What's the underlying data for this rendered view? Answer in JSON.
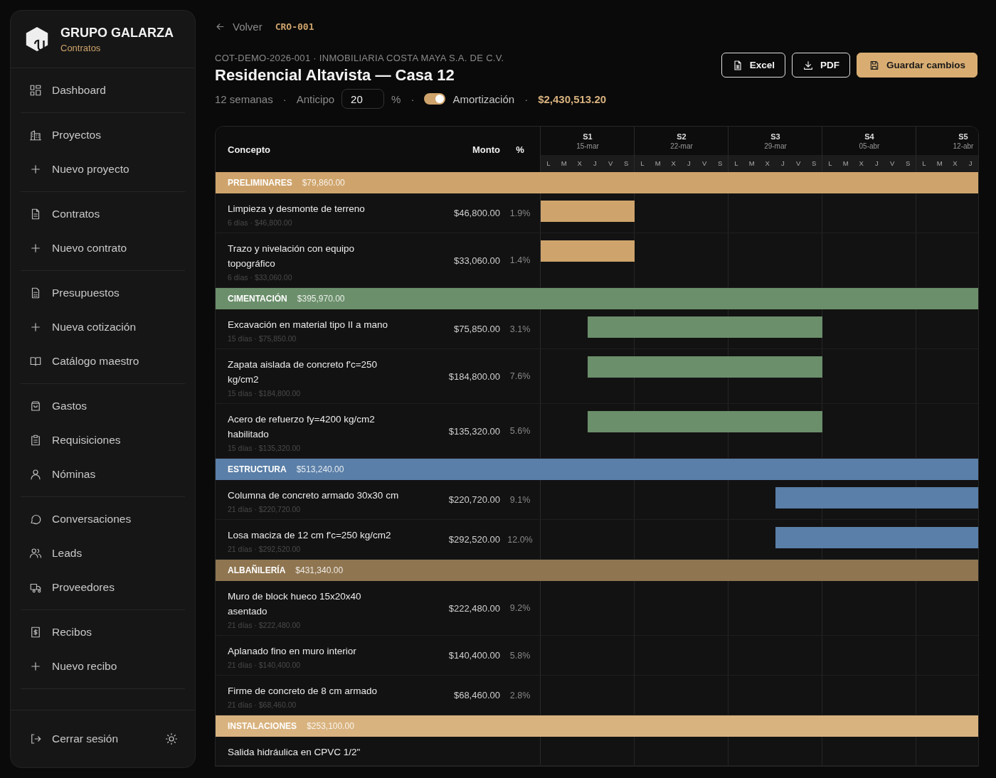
{
  "sidebar": {
    "brand": "GRUPO GALARZA",
    "subtitle": "Contratos",
    "groups": [
      [
        {
          "label": "Dashboard",
          "kind": "grid"
        }
      ],
      [
        {
          "label": "Proyectos",
          "kind": "building"
        },
        {
          "label": "Nuevo proyecto",
          "kind": "plus"
        }
      ],
      [
        {
          "label": "Contratos",
          "kind": "doc"
        },
        {
          "label": "Nuevo contrato",
          "kind": "plus"
        }
      ],
      [
        {
          "label": "Presupuestos",
          "kind": "calc"
        },
        {
          "label": "Nueva cotización",
          "kind": "plus"
        },
        {
          "label": "Catálogo maestro",
          "kind": "book"
        }
      ],
      [
        {
          "label": "Gastos",
          "kind": "bag"
        },
        {
          "label": "Requisiciones",
          "kind": "clipboard"
        },
        {
          "label": "Nóminas",
          "kind": "user"
        }
      ],
      [
        {
          "label": "Conversaciones",
          "kind": "chat"
        },
        {
          "label": "Leads",
          "kind": "users"
        },
        {
          "label": "Proveedores",
          "kind": "truck"
        }
      ],
      [
        {
          "label": "Recibos",
          "kind": "receipt"
        },
        {
          "label": "Nuevo recibo",
          "kind": "plus"
        }
      ]
    ],
    "logout": "Cerrar sesión"
  },
  "breadcrumb": {
    "back": "Volver",
    "code": "CRO-001"
  },
  "header": {
    "subtitle": "COT-DEMO-2026-001 · INMOBILIARIA COSTA MAYA S.A. DE C.V.",
    "title": "Residencial Altavista — Casa 12",
    "weeks": "12 semanas",
    "advance_label": "Anticipo",
    "advance_value": "20",
    "percent": "%",
    "separator": "·",
    "amortization": {
      "label": "Amortización",
      "on": true
    },
    "total": "$2,430,513.20"
  },
  "buttons": [
    {
      "label": "Excel",
      "kind": "excel"
    },
    {
      "label": "PDF",
      "kind": "pdf"
    },
    {
      "label": "Guardar cambios",
      "kind": "save"
    }
  ],
  "table": {
    "columns": [
      "Concepto",
      "Monto",
      "%"
    ],
    "weeks": [
      {
        "label": "S1",
        "date": "15-mar",
        "days": [
          "L",
          "M",
          "X",
          "J",
          "V",
          "S"
        ]
      },
      {
        "label": "S2",
        "date": "22-mar",
        "days": [
          "L",
          "M",
          "X",
          "J",
          "V",
          "S"
        ]
      },
      {
        "label": "S3",
        "date": "29-mar",
        "days": [
          "L",
          "M",
          "X",
          "J",
          "V",
          "S"
        ]
      },
      {
        "label": "S4",
        "date": "05-abr",
        "days": [
          "L",
          "M",
          "X",
          "J",
          "V",
          "S"
        ]
      },
      {
        "label": "S5",
        "date": "12-abr",
        "days": [
          "L",
          "M",
          "X",
          "J"
        ]
      }
    ],
    "sections": [
      {
        "name": "PRELIMINARES",
        "amount": "$79,860.00",
        "color": "#cfa46c",
        "rows": [
          {
            "concept": "Limpieza y desmonte de terreno",
            "meta": "6 días · $46,800.00",
            "amount": "$46,800.00",
            "pct": "1.9%"
          },
          {
            "concept": "Trazo y nivelación con equipo topográfico",
            "meta": "6 días · $33,060.00",
            "amount": "$33,060.00",
            "pct": "1.4%"
          }
        ]
      },
      {
        "name": "CIMENTACIÓN",
        "amount": "$395,970.00",
        "color": "#6b8f6b",
        "rows": [
          {
            "concept": "Excavación en material tipo II a mano",
            "meta": "15 días · $75,850.00",
            "amount": "$75,850.00",
            "pct": "3.1%"
          },
          {
            "concept": "Zapata aislada de concreto f'c=250 kg/cm2",
            "meta": "15 días · $184,800.00",
            "amount": "$184,800.00",
            "pct": "7.6%"
          },
          {
            "concept": "Acero de refuerzo fy=4200 kg/cm2 habilitado",
            "meta": "15 días · $135,320.00",
            "amount": "$135,320.00",
            "pct": "5.6%"
          }
        ]
      },
      {
        "name": "ESTRUCTURA",
        "amount": "$513,240.00",
        "color": "#5a7fa8",
        "rows": [
          {
            "concept": "Columna de concreto armado 30x30 cm",
            "meta": "21 días · $220,720.00",
            "amount": "$220,720.00",
            "pct": "9.1%"
          },
          {
            "concept": "Losa maciza de 12 cm f'c=250 kg/cm2",
            "meta": "21 días · $292,520.00",
            "amount": "$292,520.00",
            "pct": "12.0%"
          }
        ]
      },
      {
        "name": "ALBAÑILERÍA",
        "amount": "$431,340.00",
        "color": "#8f7550",
        "rows": [
          {
            "concept": "Muro de block hueco 15x20x40 asentado",
            "meta": "21 días · $222,480.00",
            "amount": "$222,480.00",
            "pct": "9.2%"
          },
          {
            "concept": "Aplanado fino en muro interior",
            "meta": "21 días · $140,400.00",
            "amount": "$140,400.00",
            "pct": "5.8%"
          },
          {
            "concept": "Firme de concreto de 8 cm armado",
            "meta": "21 días · $68,460.00",
            "amount": "$68,460.00",
            "pct": "2.8%"
          }
        ]
      },
      {
        "name": "INSTALACIONES",
        "amount": "$253,100.00",
        "color": "#d9b37f",
        "rows": [
          {
            "concept": "Salida hidráulica en CPVC 1/2\""
          }
        ]
      }
    ]
  }
}
